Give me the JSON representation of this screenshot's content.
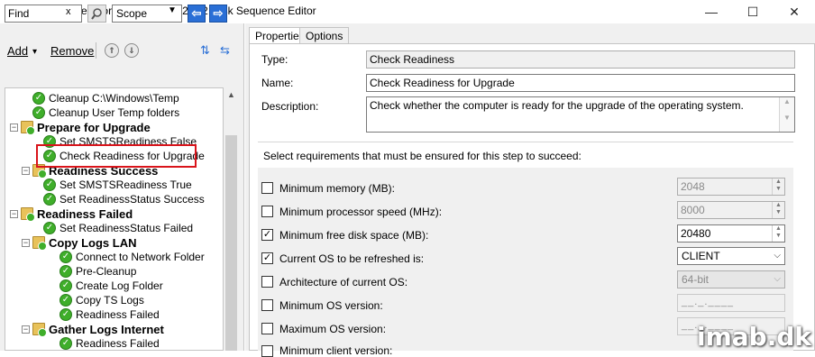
{
  "window": {
    "title": "PreCache Content for Windows 10 v20H2 Task Sequence Editor",
    "minimize": "—",
    "maximize": "☐",
    "close": "✕"
  },
  "search": {
    "find_placeholder": "Find",
    "clear": "x",
    "scope_value": "Scope",
    "prev": "⇦",
    "next": "⇨"
  },
  "toolbar": {
    "add": "Add",
    "add_arrow": "▾",
    "remove": "Remove",
    "up": "⇑",
    "down": "⇓",
    "tool1": "⇅",
    "tool2": "⇆"
  },
  "tree": {
    "items": [
      {
        "label": "Cleanup C:\\Windows\\Temp",
        "type": "step"
      },
      {
        "label": "Cleanup User Temp folders",
        "type": "step"
      },
      {
        "label": "Prepare for Upgrade",
        "type": "group"
      },
      {
        "label": "Set SMSTSReadiness False",
        "type": "step"
      },
      {
        "label": "Check Readiness for Upgrade",
        "type": "step"
      },
      {
        "label": "Readiness Success",
        "type": "group"
      },
      {
        "label": "Set SMSTSReadiness True",
        "type": "step"
      },
      {
        "label": "Set ReadinessStatus Success",
        "type": "step"
      },
      {
        "label": "Readiness Failed",
        "type": "group"
      },
      {
        "label": "Set ReadinessStatus Failed",
        "type": "step"
      },
      {
        "label": "Copy Logs LAN",
        "type": "group"
      },
      {
        "label": "Connect to Network Folder",
        "type": "step"
      },
      {
        "label": "Pre-Cleanup",
        "type": "step"
      },
      {
        "label": "Create Log Folder",
        "type": "step"
      },
      {
        "label": "Copy TS Logs",
        "type": "step"
      },
      {
        "label": "Readiness Failed",
        "type": "step"
      },
      {
        "label": "Gather Logs Internet",
        "type": "group"
      },
      {
        "label": "Readiness Failed",
        "type": "step"
      }
    ]
  },
  "tabs": {
    "properties": "Properties",
    "options": "Options"
  },
  "properties": {
    "type_label": "Type:",
    "type_value": "Check Readiness",
    "name_label": "Name:",
    "name_value": "Check Readiness for Upgrade",
    "description_label": "Description:",
    "description_value": "Check whether the computer is ready for the upgrade of the operating system.",
    "requirements_intro": "Select requirements that must be ensured for this step to succeed:"
  },
  "requirements": [
    {
      "label": "Minimum memory (MB):",
      "checked": false,
      "value": "2048"
    },
    {
      "label": "Minimum processor speed (MHz):",
      "checked": false,
      "value": "8000"
    },
    {
      "label": "Minimum free disk space (MB):",
      "checked": true,
      "value": "20480"
    },
    {
      "label": "Current OS to be refreshed is:",
      "checked": true,
      "value": "CLIENT"
    },
    {
      "label": "Architecture of current OS:",
      "checked": false,
      "value": "64-bit"
    },
    {
      "label": "Minimum OS version:",
      "checked": false,
      "value": "__._.____"
    },
    {
      "label": "Maximum OS version:",
      "checked": false,
      "value": "__._.____"
    },
    {
      "label": "Minimum client version:",
      "checked": false,
      "value": ""
    }
  ],
  "watermark": "imab.dk",
  "colors": {
    "highlight": "#d9141b",
    "check_green": "#3fae2a",
    "nav_blue": "#2a6fd6"
  }
}
